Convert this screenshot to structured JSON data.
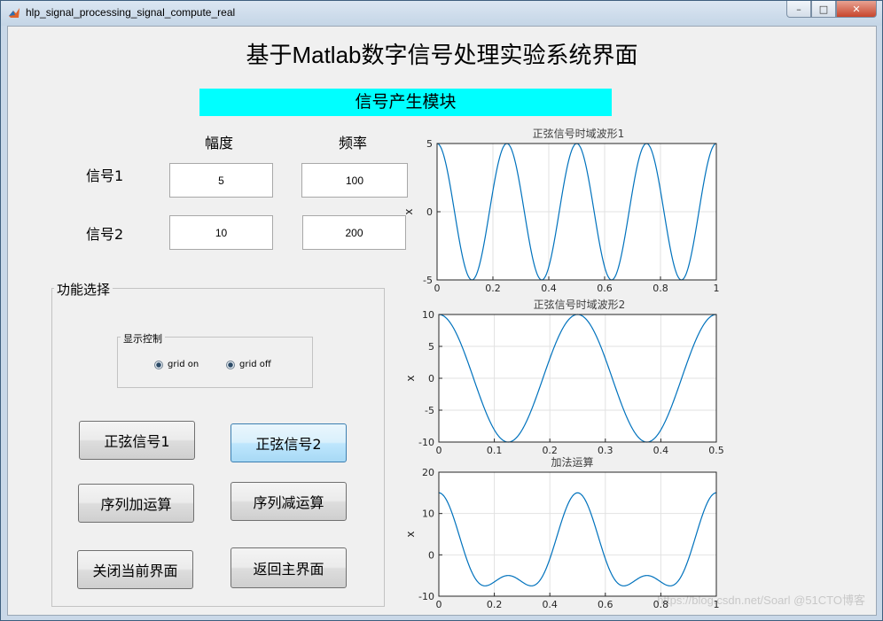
{
  "window": {
    "title": "hlp_signal_processing_signal_compute_real",
    "controls": {
      "minimize": "–",
      "maximize": "□",
      "close": "✕"
    }
  },
  "page": {
    "title": "基于Matlab数字信号处理实验系统界面",
    "module_banner": "信号产生模块",
    "col_amplitude": "幅度",
    "col_frequency": "频率",
    "signal1_label": "信号1",
    "signal2_label": "信号2"
  },
  "inputs": {
    "signal1_amplitude": "5",
    "signal1_frequency": "100",
    "signal2_amplitude": "10",
    "signal2_frequency": "200"
  },
  "function_panel": {
    "title": "功能选择",
    "display_control": {
      "title": "显示控制",
      "grid_on": "grid on",
      "grid_off": "grid off"
    },
    "buttons": {
      "sine1": "正弦信号1",
      "sine2": "正弦信号2",
      "seq_add": "序列加运算",
      "seq_sub": "序列减运算",
      "close_current": "关闭当前界面",
      "return_main": "返回主界面"
    }
  },
  "watermark": "https://blog.csdn.net/Soarl  @51CTO博客",
  "colors": {
    "accent_banner": "#00ffff",
    "plot_line": "#0072bd"
  },
  "chart_data": [
    {
      "type": "line",
      "title": "正弦信号时域波形1",
      "ylabel": "x",
      "xlim": [
        0,
        1
      ],
      "ylim": [
        -5,
        5
      ],
      "xticks": [
        0,
        0.2,
        0.4,
        0.6,
        0.8,
        1
      ],
      "yticks": [
        -5,
        0,
        5
      ],
      "grid": true,
      "series": [
        {
          "expression": "5*cos(2*pi*4*t)",
          "amplitude": 5,
          "cycles_per_unit": 4
        }
      ]
    },
    {
      "type": "line",
      "title": "正弦信号时域波形2",
      "ylabel": "x",
      "xlim": [
        0,
        0.5
      ],
      "ylim": [
        -10,
        10
      ],
      "xticks": [
        0,
        0.1,
        0.2,
        0.3,
        0.4,
        0.5
      ],
      "yticks": [
        -10,
        -5,
        0,
        5,
        10
      ],
      "grid": true,
      "series": [
        {
          "expression": "10*cos(2*pi*4*t)",
          "amplitude": 10,
          "cycles_per_unit": 4
        }
      ]
    },
    {
      "type": "line",
      "title": "加法运算",
      "ylabel": "x",
      "xlim": [
        0,
        1
      ],
      "ylim": [
        -10,
        20
      ],
      "xticks": [
        0,
        0.2,
        0.4,
        0.6,
        0.8,
        1
      ],
      "yticks": [
        -10,
        0,
        10,
        20
      ],
      "grid": true,
      "series": [
        {
          "expression": "5*cos(2*pi*4*t)+10*cos(2*pi*2*t)"
        }
      ]
    }
  ]
}
